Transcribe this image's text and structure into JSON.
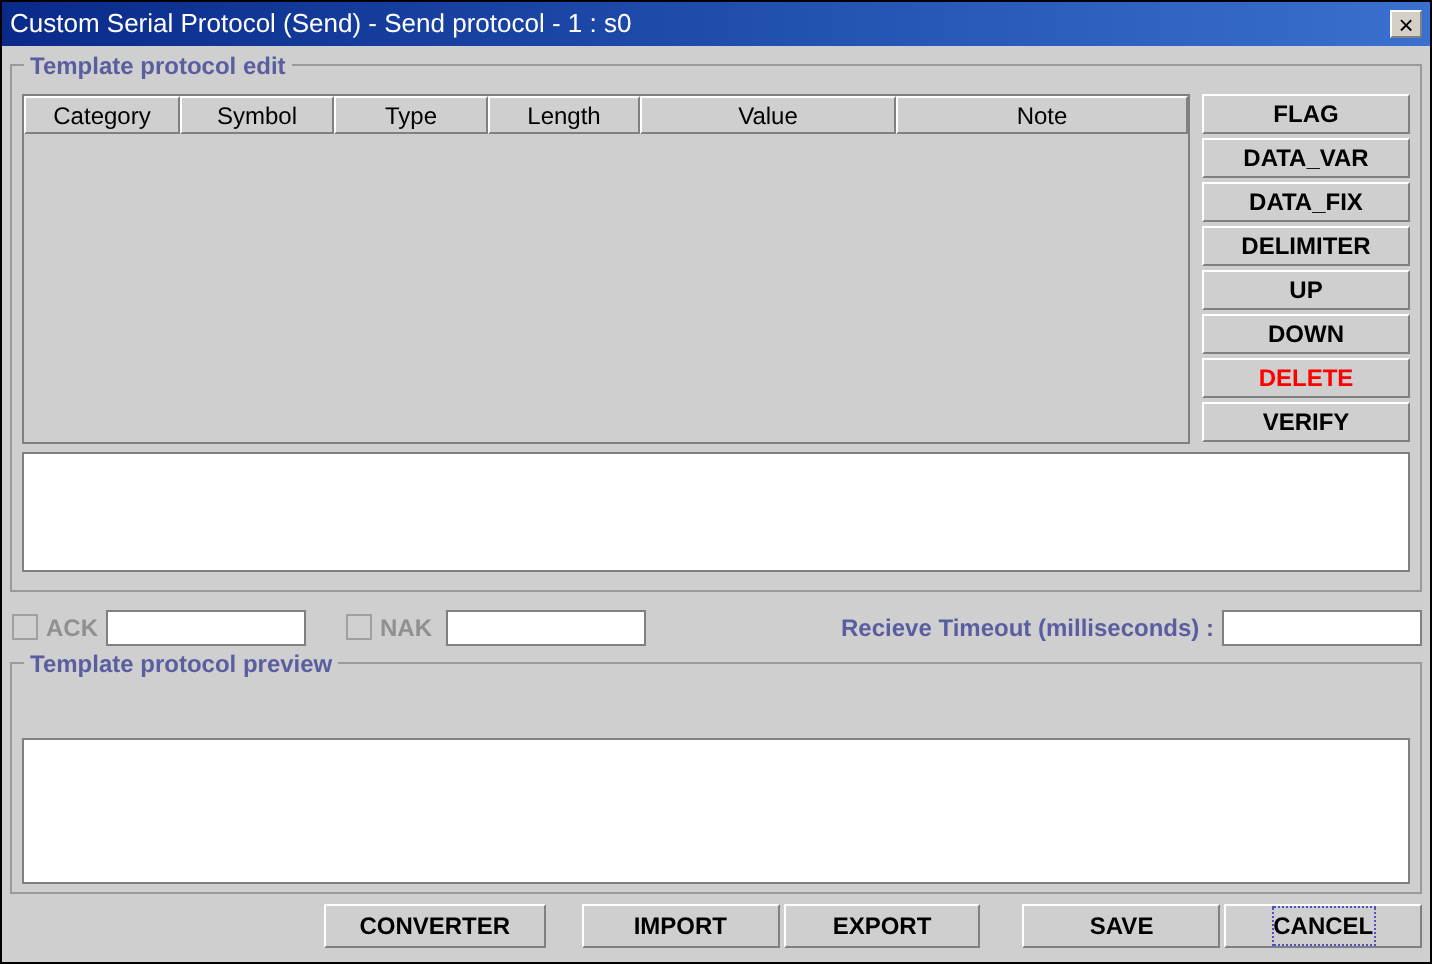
{
  "window": {
    "title": "Custom Serial Protocol (Send) - Send protocol - 1 : s0",
    "close": "×"
  },
  "edit_group": {
    "title": "Template protocol edit",
    "table": {
      "columns": [
        "Category",
        "Symbol",
        "Type",
        "Length",
        "Value",
        "Note"
      ]
    },
    "side_buttons": [
      {
        "label": "FLAG",
        "kind": "normal"
      },
      {
        "label": "DATA_VAR",
        "kind": "normal"
      },
      {
        "label": "DATA_FIX",
        "kind": "normal"
      },
      {
        "label": "DELIMITER",
        "kind": "normal"
      },
      {
        "label": "UP",
        "kind": "normal"
      },
      {
        "label": "DOWN",
        "kind": "normal"
      },
      {
        "label": "DELETE",
        "kind": "danger"
      },
      {
        "label": "VERIFY",
        "kind": "normal"
      }
    ]
  },
  "options": {
    "ack": {
      "label": "ACK",
      "checked": false,
      "disabled": true
    },
    "nak": {
      "label": "NAK",
      "checked": false,
      "disabled": true
    },
    "timeout_label": "Recieve Timeout (milliseconds) :"
  },
  "preview_group": {
    "title": "Template protocol preview"
  },
  "buttons": [
    {
      "label": "CONVERTER",
      "focused": false
    },
    {
      "label": "IMPORT",
      "focused": false
    },
    {
      "label": "EXPORT",
      "focused": false
    },
    {
      "label": "SAVE",
      "focused": false
    },
    {
      "label": "CANCEL",
      "focused": true
    }
  ]
}
